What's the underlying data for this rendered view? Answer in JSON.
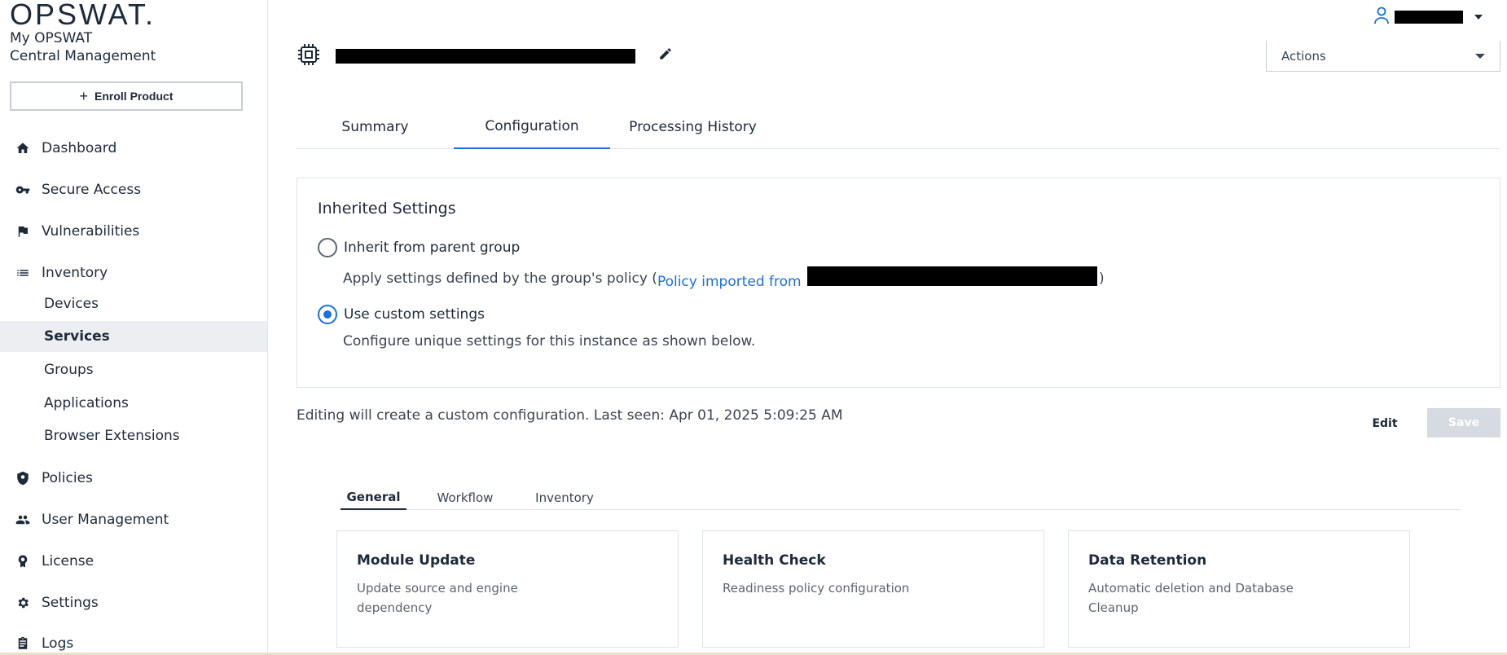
{
  "brand": {
    "logo": "OPSWAT.",
    "line1": "My OPSWAT",
    "line2": "Central Management"
  },
  "sidebar": {
    "enroll_label": "Enroll Product",
    "items": [
      {
        "label": "Dashboard",
        "icon": "home-icon"
      },
      {
        "label": "Secure Access",
        "icon": "key-icon"
      },
      {
        "label": "Vulnerabilities",
        "icon": "flag-icon"
      },
      {
        "label": "Inventory",
        "icon": "list-icon"
      },
      {
        "label": "Policies",
        "icon": "shield-icon"
      },
      {
        "label": "User Management",
        "icon": "users-icon"
      },
      {
        "label": "License",
        "icon": "badge-icon"
      },
      {
        "label": "Settings",
        "icon": "gear-icon"
      },
      {
        "label": "Logs",
        "icon": "clipboard-icon"
      }
    ],
    "inventory_sub": [
      {
        "label": "Devices",
        "active": false
      },
      {
        "label": "Services",
        "active": true
      },
      {
        "label": "Groups",
        "active": false
      },
      {
        "label": "Applications",
        "active": false
      },
      {
        "label": "Browser Extensions",
        "active": false
      }
    ]
  },
  "header": {
    "actions_label": "Actions"
  },
  "tabs": [
    {
      "label": "Summary",
      "active": false
    },
    {
      "label": "Configuration",
      "active": true
    },
    {
      "label": "Processing History",
      "active": false
    }
  ],
  "inherited": {
    "heading": "Inherited Settings",
    "option1_label": "Inherit from parent group",
    "option1_desc_prefix": "Apply settings defined by the group's policy (",
    "option1_link_prefix": "Policy imported from",
    "option1_desc_suffix": ")",
    "option2_label": "Use custom settings",
    "option2_desc": "Configure unique settings for this instance as shown below.",
    "selected": "custom"
  },
  "edit_note": "Editing will create a custom configuration. Last seen: Apr 01, 2025 5:09:25 AM",
  "buttons": {
    "edit": "Edit",
    "save": "Save"
  },
  "subtabs": [
    {
      "label": "General",
      "active": true
    },
    {
      "label": "Workflow",
      "active": false
    },
    {
      "label": "Inventory",
      "active": false
    }
  ],
  "cards": [
    {
      "title": "Module Update",
      "desc": "Update source and engine dependency"
    },
    {
      "title": "Health Check",
      "desc": "Readiness policy configuration"
    },
    {
      "title": "Data Retention",
      "desc": "Automatic deletion and Database Cleanup"
    }
  ],
  "colors": {
    "accent": "#1d6fd8",
    "text": "#1d2a3a",
    "active_bg": "#eceef1",
    "save_disabled": "#d6dbe2"
  }
}
